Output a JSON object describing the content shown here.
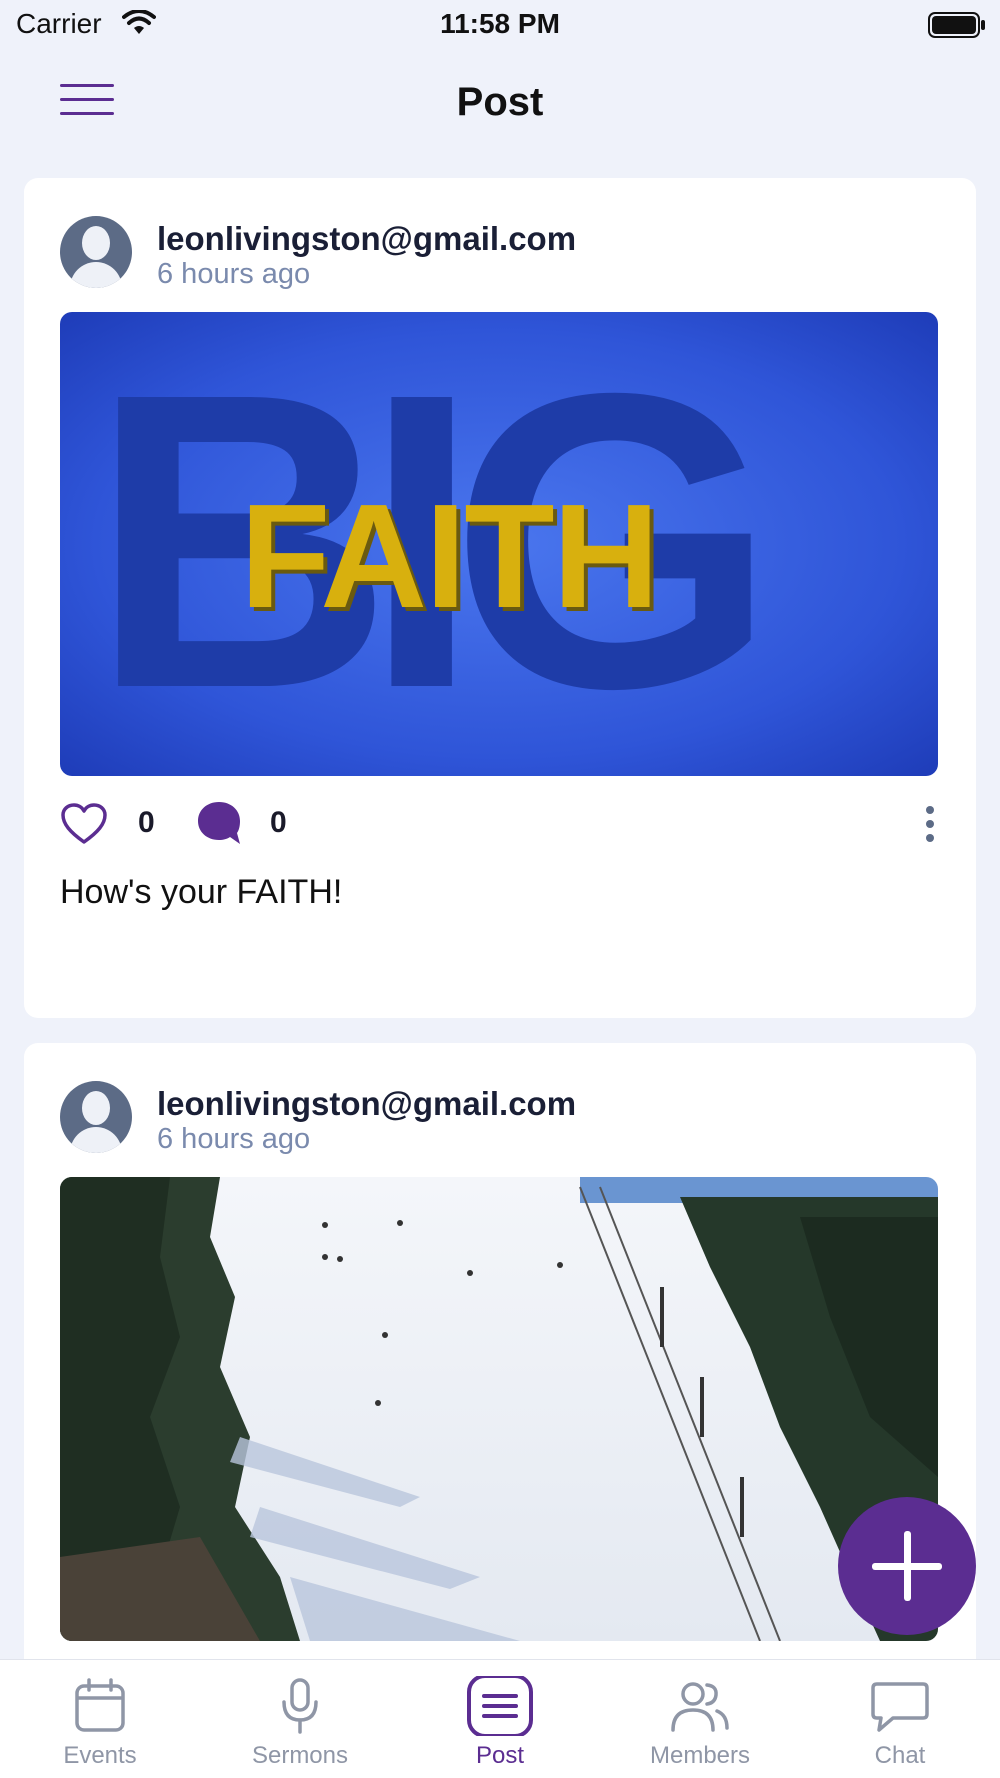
{
  "status_bar": {
    "carrier": "Carrier",
    "time": "11:58 PM"
  },
  "header": {
    "title": "Post",
    "menu_icon": "hamburger-menu-icon"
  },
  "posts": [
    {
      "author": "leonlivingston@gmail.com",
      "time": "6 hours ago",
      "image": {
        "big_text": "BIG",
        "overlay_text": "FAITH"
      },
      "likes": "0",
      "comments": "0",
      "caption": "How's your FAITH!"
    },
    {
      "author": "leonlivingston@gmail.com",
      "time": "6 hours ago"
    }
  ],
  "fab": {
    "icon": "plus-icon"
  },
  "tab_bar": {
    "items": [
      {
        "label": "Events",
        "icon": "calendar-icon"
      },
      {
        "label": "Sermons",
        "icon": "microphone-icon"
      },
      {
        "label": "Post",
        "icon": "list-icon",
        "active": true
      },
      {
        "label": "Members",
        "icon": "people-icon"
      },
      {
        "label": "Chat",
        "icon": "chat-bubble-icon"
      }
    ]
  },
  "colors": {
    "accent": "#5b2d91",
    "background": "#eff2fa",
    "muted": "#7a8aad"
  }
}
